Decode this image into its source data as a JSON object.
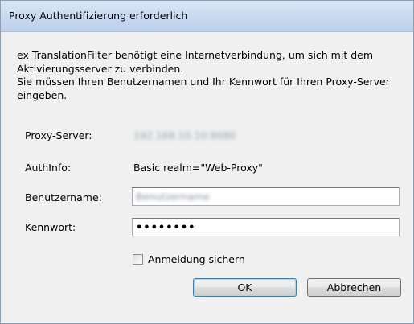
{
  "window": {
    "title": "Proxy Authentifizierung erforderlich"
  },
  "message": {
    "line1": "ex TranslationFilter benötigt eine Internetverbindung, um sich mit dem Aktivierungsserver zu verbinden.",
    "line2": "Sie müssen Ihren Benutzernamen und Ihr Kennwort für Ihren Proxy-Server eingeben."
  },
  "fields": {
    "proxy_server_label": "Proxy-Server:",
    "proxy_server_value": "192.168.10.10:8080",
    "authinfo_label": "AuthInfo:",
    "authinfo_value": "Basic realm=\"Web-Proxy\"",
    "username_label": "Benutzername:",
    "username_value": "Benutzername",
    "password_label": "Kennwort:",
    "password_value": "••••••••"
  },
  "checkbox": {
    "label": "Anmeldung sichern",
    "checked": false
  },
  "buttons": {
    "ok": "OK",
    "cancel": "Abbrechen"
  }
}
